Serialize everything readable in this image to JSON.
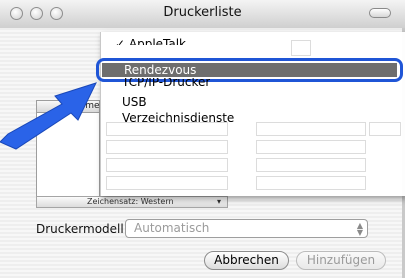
{
  "window": {
    "title": "Druckerliste"
  },
  "menu": {
    "items": [
      {
        "label": "✓ AppleTalk"
      },
      {
        "label": "Rendezvous"
      },
      {
        "label": "TCP/IP-Drucker"
      },
      {
        "label": "USB"
      },
      {
        "label": "Verzeichnisdienste"
      }
    ]
  },
  "list": {
    "column_header": "Name",
    "charset": "Zeichensatz: Western"
  },
  "form": {
    "model_label": "Druckermodell:",
    "model_value": "Automatisch"
  },
  "buttons": {
    "cancel": "Abbrechen",
    "add": "Hinzufügen"
  },
  "colors": {
    "highlight_border": "#1f55d6",
    "arrow": "#2a63e8",
    "selection": "#6e6e6e"
  },
  "icons": [
    "close-icon",
    "minimize-icon",
    "zoom-icon",
    "toolbar-toggle-icon",
    "pointer-arrow-icon",
    "chevron-updown-icon"
  ]
}
